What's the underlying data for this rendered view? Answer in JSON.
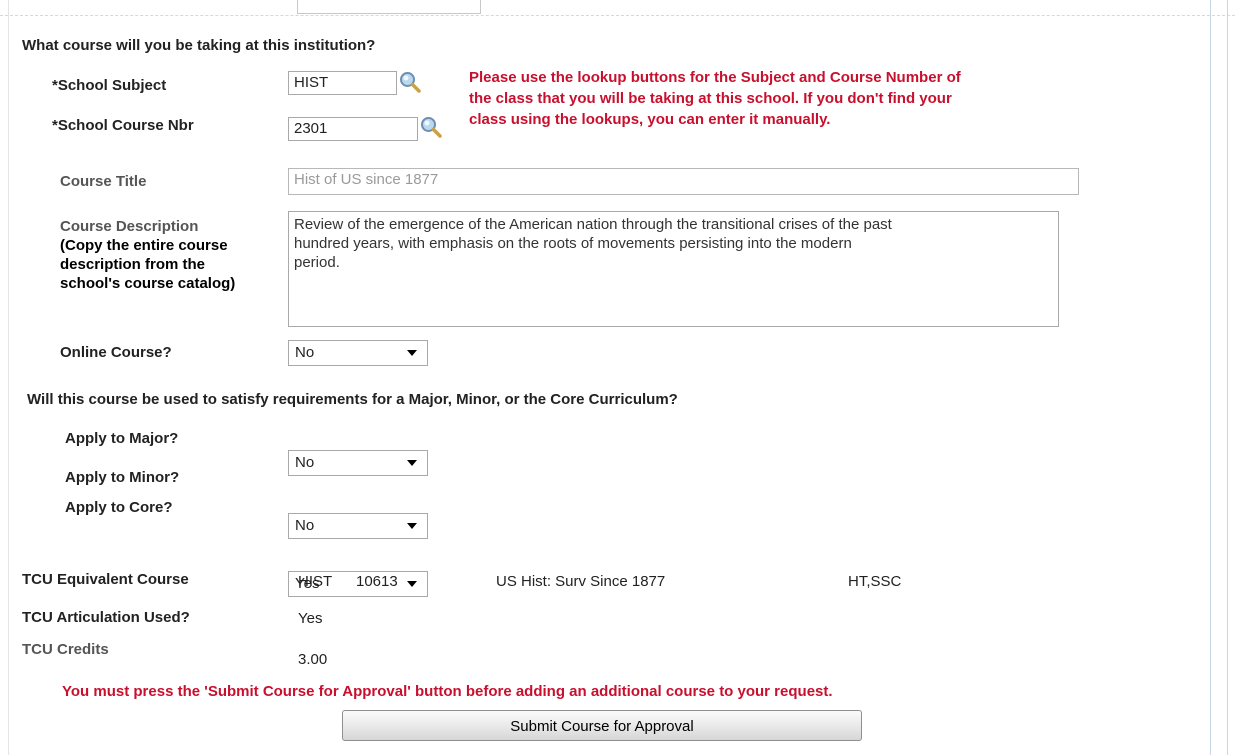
{
  "course_section": {
    "heading": "What course will you be taking at this institution?",
    "subject": {
      "label": "*School Subject",
      "value": "HIST"
    },
    "course_nbr": {
      "label": "*School Course Nbr",
      "value": "2301"
    },
    "lookup_note": [
      "Please use the lookup buttons for the Subject and Course Number of",
      "the class that you will be taking at this school. If you don't find your",
      "class using the lookups, you can enter it manually."
    ],
    "course_title": {
      "label": "Course Title",
      "value": "Hist of US since 1877"
    },
    "course_description": {
      "label_lines": [
        "Course Description",
        "(Copy the entire course",
        "description from the",
        "school's course catalog)"
      ],
      "value_lines": [
        "Review of the emergence of the American nation through the transitional crises of the past",
        "hundred years, with emphasis on the roots of movements persisting into the modern",
        "period."
      ]
    },
    "online_course": {
      "label": "Online Course?",
      "value": "No"
    }
  },
  "requirements_section": {
    "heading": "Will this course be used to satisfy requirements for a Major, Minor, or the Core Curriculum?",
    "major": {
      "label": "Apply to Major?",
      "value": "No"
    },
    "minor": {
      "label": "Apply to Minor?",
      "value": "No"
    },
    "core": {
      "label": "Apply to Core?",
      "value": "Yes"
    }
  },
  "tcu_section": {
    "equivalent": {
      "label": "TCU Equivalent Course",
      "subject": "HIST",
      "number": "10613",
      "title": "US Hist: Surv Since 1877",
      "attributes": "HT,SSC"
    },
    "articulation": {
      "label": "TCU Articulation Used?",
      "value": "Yes"
    },
    "credits": {
      "label": "TCU Credits",
      "value": "3.00"
    }
  },
  "warning": "You must press the 'Submit Course for Approval' button before adding an additional course to your request.",
  "submit_label": "Submit Course for Approval",
  "colors": {
    "alert_red": "#c8102e",
    "label_gray": "#555555"
  },
  "icons": {
    "lookup": "magnifier-icon",
    "dropdown": "chevron-down-icon"
  }
}
